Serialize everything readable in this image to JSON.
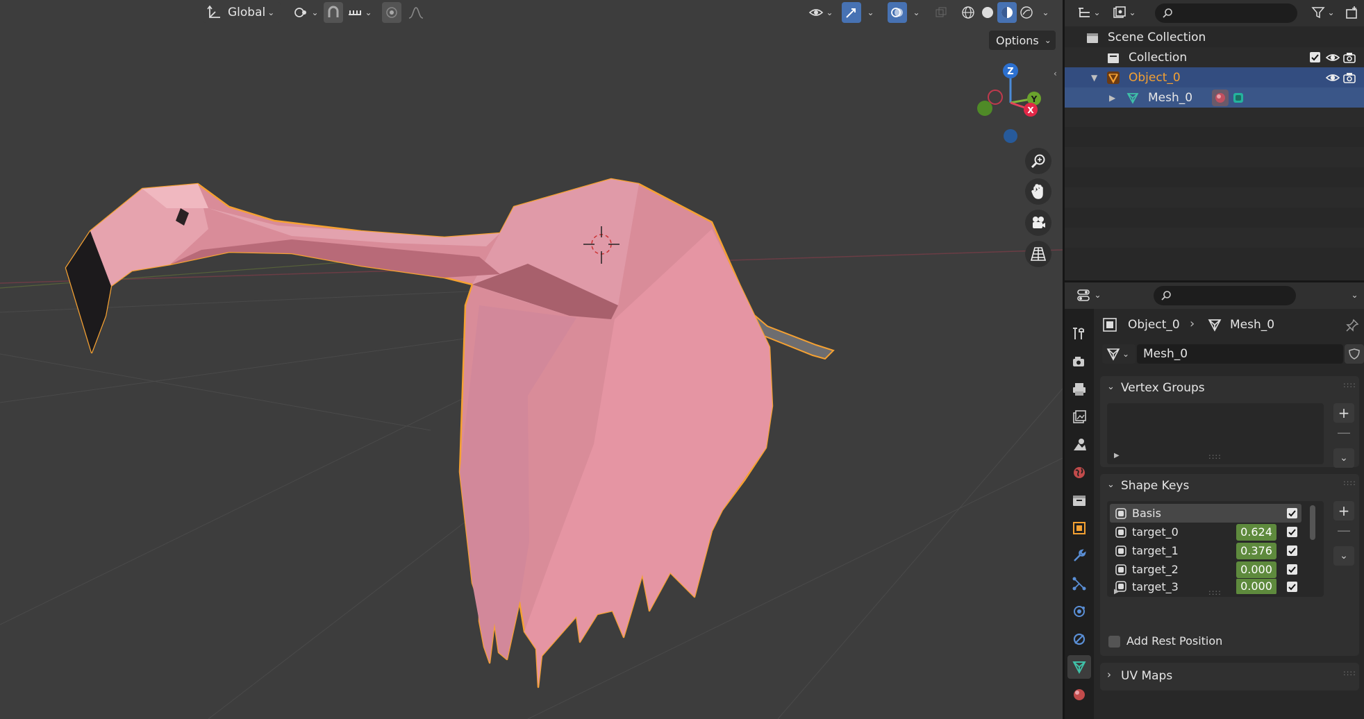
{
  "viewport": {
    "orientation_label": "Global",
    "options_label": "Options"
  },
  "outliner": {
    "rows": [
      {
        "label": "Scene Collection"
      },
      {
        "label": "Collection"
      },
      {
        "label": "Object_0"
      },
      {
        "label": "Mesh_0"
      }
    ]
  },
  "properties": {
    "breadcrumb": {
      "object": "Object_0",
      "mesh": "Mesh_0"
    },
    "datablock_name": "Mesh_0",
    "vertex_groups": {
      "title": "Vertex Groups"
    },
    "shape_keys": {
      "title": "Shape Keys",
      "keys": [
        {
          "name": "Basis",
          "value": ""
        },
        {
          "name": "target_0",
          "value": "0.624"
        },
        {
          "name": "target_1",
          "value": "0.376"
        },
        {
          "name": "target_2",
          "value": "0.000"
        },
        {
          "name": "target_3",
          "value": "0.000"
        }
      ],
      "add_rest_position": "Add Rest Position"
    },
    "uv_maps": {
      "title": "UV Maps"
    }
  },
  "colors": {
    "selection_outline": "#f5a132",
    "active_row": "#334d80",
    "shape_key_value": "#5e8a3d",
    "mesh": "#d98c99"
  }
}
